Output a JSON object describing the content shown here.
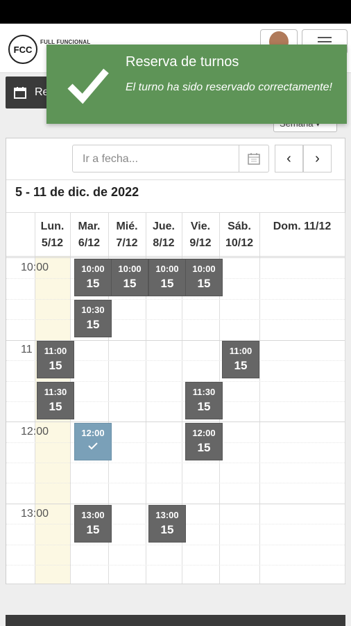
{
  "header": {
    "logo_text": "FCC",
    "brand": "FULL FUNCIONAL"
  },
  "page": {
    "button_label": "Re",
    "view_select": "Semana"
  },
  "toast": {
    "title": "Reserva de turnos",
    "message": "El turno ha sido reservado correctamente!"
  },
  "calendar": {
    "date_placeholder": "Ir a fecha...",
    "range": "5 - 11 de dic. de 2022",
    "days": [
      {
        "l1": "Lun.",
        "l2": "5/12"
      },
      {
        "l1": "Mar.",
        "l2": "6/12"
      },
      {
        "l1": "Mié.",
        "l2": "7/12"
      },
      {
        "l1": "Jue.",
        "l2": "8/12"
      },
      {
        "l1": "Vie.",
        "l2": "9/12"
      },
      {
        "l1": "Sáb.",
        "l2": "10/12"
      },
      {
        "l1": "Dom. 11/12",
        "l2": ""
      }
    ],
    "times": [
      "10:00",
      "11",
      "12:00",
      "13:00"
    ],
    "events": [
      {
        "time": "10:00",
        "count": "15"
      },
      {
        "time": "10:00",
        "count": "15"
      },
      {
        "time": "10:00",
        "count": "15"
      },
      {
        "time": "10:00",
        "count": "15"
      },
      {
        "time": "10:30",
        "count": "15"
      },
      {
        "time": "11:00",
        "count": "15"
      },
      {
        "time": "11:00",
        "count": "15"
      },
      {
        "time": "11:30",
        "count": "15"
      },
      {
        "time": "11:30",
        "count": "15"
      },
      {
        "time": "12:00",
        "count": ""
      },
      {
        "time": "12:00",
        "count": "15"
      },
      {
        "time": "13:00",
        "count": "15"
      },
      {
        "time": "13:00",
        "count": "15"
      }
    ]
  },
  "colors": {
    "toast": "#5e9457",
    "event": "#666666",
    "booked": "#7aa0b8",
    "today": "#fcf8e3"
  }
}
